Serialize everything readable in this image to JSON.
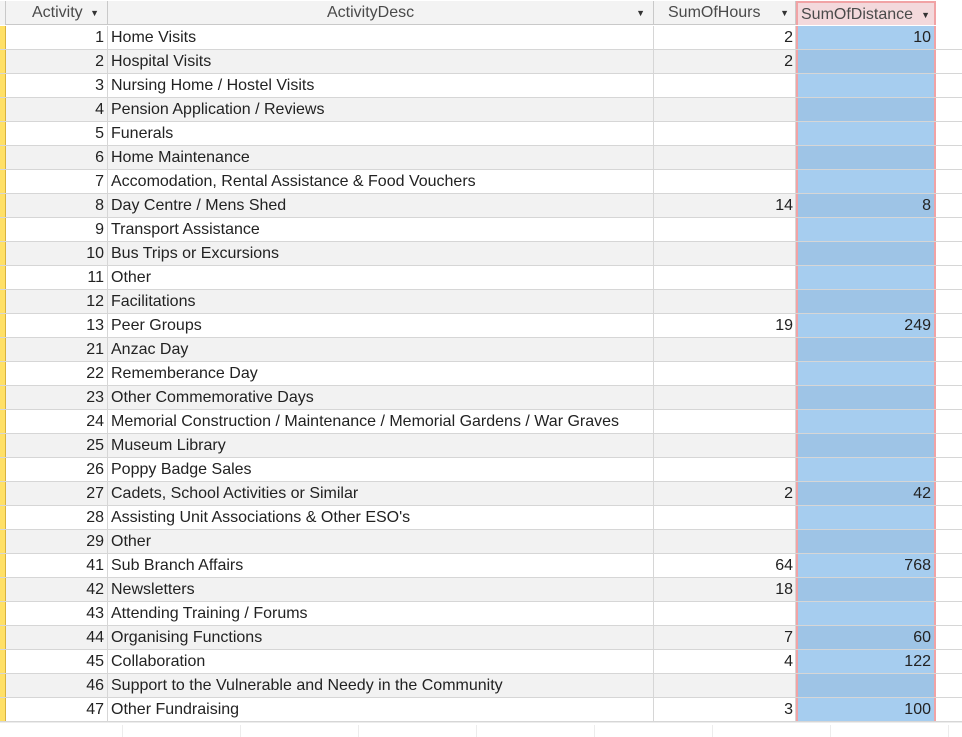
{
  "table": {
    "columns": {
      "activity": "Activity",
      "desc": "ActivityDesc",
      "hours": "SumOfHours",
      "distance": "SumOfDistance"
    },
    "rows": [
      {
        "activity": "1",
        "desc": "Home Visits",
        "hours": "2",
        "distance": "10"
      },
      {
        "activity": "2",
        "desc": "Hospital Visits",
        "hours": "2",
        "distance": ""
      },
      {
        "activity": "3",
        "desc": "Nursing Home / Hostel Visits",
        "hours": "",
        "distance": ""
      },
      {
        "activity": "4",
        "desc": "Pension Application / Reviews",
        "hours": "",
        "distance": ""
      },
      {
        "activity": "5",
        "desc": "Funerals",
        "hours": "",
        "distance": ""
      },
      {
        "activity": "6",
        "desc": "Home Maintenance",
        "hours": "",
        "distance": ""
      },
      {
        "activity": "7",
        "desc": "Accomodation, Rental Assistance & Food Vouchers",
        "hours": "",
        "distance": ""
      },
      {
        "activity": "8",
        "desc": "Day Centre / Mens Shed",
        "hours": "14",
        "distance": "8"
      },
      {
        "activity": "9",
        "desc": "Transport Assistance",
        "hours": "",
        "distance": ""
      },
      {
        "activity": "10",
        "desc": "Bus Trips or Excursions",
        "hours": "",
        "distance": ""
      },
      {
        "activity": "11",
        "desc": "Other",
        "hours": "",
        "distance": ""
      },
      {
        "activity": "12",
        "desc": "Facilitations",
        "hours": "",
        "distance": ""
      },
      {
        "activity": "13",
        "desc": "Peer Groups",
        "hours": "19",
        "distance": "249"
      },
      {
        "activity": "21",
        "desc": "Anzac Day",
        "hours": "",
        "distance": ""
      },
      {
        "activity": "22",
        "desc": "Rememberance Day",
        "hours": "",
        "distance": ""
      },
      {
        "activity": "23",
        "desc": "Other Commemorative Days",
        "hours": "",
        "distance": ""
      },
      {
        "activity": "24",
        "desc": "Memorial Construction / Maintenance / Memorial Gardens / War Graves",
        "hours": "",
        "distance": ""
      },
      {
        "activity": "25",
        "desc": "Museum Library",
        "hours": "",
        "distance": ""
      },
      {
        "activity": "26",
        "desc": "Poppy Badge Sales",
        "hours": "",
        "distance": ""
      },
      {
        "activity": "27",
        "desc": "Cadets, School Activities or Similar",
        "hours": "2",
        "distance": "42"
      },
      {
        "activity": "28",
        "desc": "Assisting Unit Associations & Other ESO's",
        "hours": "",
        "distance": ""
      },
      {
        "activity": "29",
        "desc": "Other",
        "hours": "",
        "distance": ""
      },
      {
        "activity": "41",
        "desc": "Sub Branch Affairs",
        "hours": "64",
        "distance": "768"
      },
      {
        "activity": "42",
        "desc": "Newsletters",
        "hours": "18",
        "distance": ""
      },
      {
        "activity": "43",
        "desc": "Attending Training / Forums",
        "hours": "",
        "distance": ""
      },
      {
        "activity": "44",
        "desc": "Organising Functions",
        "hours": "7",
        "distance": "60"
      },
      {
        "activity": "45",
        "desc": "Collaboration",
        "hours": "4",
        "distance": "122"
      },
      {
        "activity": "46",
        "desc": "Support to the Vulnerable and Needy in the Community",
        "hours": "",
        "distance": ""
      },
      {
        "activity": "47",
        "desc": "Other Fundraising",
        "hours": "3",
        "distance": "100"
      }
    ]
  },
  "icons": {
    "dropdown": "chevron-down-icon",
    "corner": "select-all-icon"
  },
  "colors": {
    "selector": "#ffe066",
    "selected_column": "#a6cdef",
    "selected_border": "#f1a3a5"
  }
}
